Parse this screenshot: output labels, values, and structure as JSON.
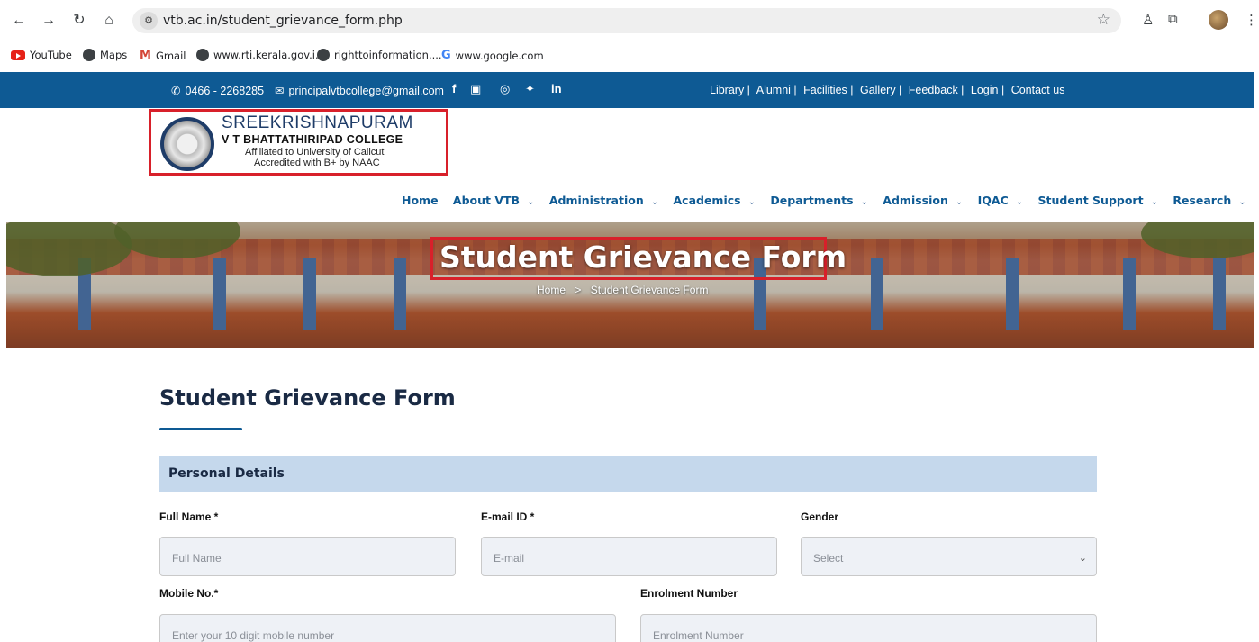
{
  "browser": {
    "url": "vtb.ac.in/student_grievance_form.php",
    "bookmarks": [
      "YouTube",
      "Maps",
      "Gmail",
      "www.rti.kerala.gov.i...",
      "righttoinformation....",
      "www.google.com"
    ]
  },
  "topbar": {
    "phone": "0466 - 2268285",
    "email": "principalvtbcollege@gmail.com",
    "social": [
      "f",
      "You",
      "ig",
      "tw",
      "in"
    ],
    "links": [
      "Library |",
      "Alumni |",
      "Facilities |",
      "Gallery |",
      "Feedback |",
      "Login |",
      "Contact us"
    ]
  },
  "logo": {
    "line1": "SREEKRISHNAPURAM",
    "line2": "V T BHATTATHIRIPAD COLLEGE",
    "line3": "Affiliated to University of Calicut",
    "line4": "Accredited with B+ by NAAC"
  },
  "nav": [
    {
      "label": "Home",
      "dropdown": false
    },
    {
      "label": "About VTB",
      "dropdown": true
    },
    {
      "label": "Administration",
      "dropdown": true
    },
    {
      "label": "Academics",
      "dropdown": true
    },
    {
      "label": "Departments",
      "dropdown": true
    },
    {
      "label": "Admission",
      "dropdown": true
    },
    {
      "label": "IQAC",
      "dropdown": true
    },
    {
      "label": "Student Support",
      "dropdown": true
    },
    {
      "label": "Research",
      "dropdown": true
    }
  ],
  "banner": {
    "title": "Student Grievance Form",
    "crumb_home": "Home",
    "crumb_sep": ">",
    "crumb_current": "Student Grievance Form"
  },
  "content": {
    "heading": "Student Grievance Form",
    "section": "Personal Details",
    "fields": {
      "full_name_label": "Full Name *",
      "full_name_placeholder": "Full Name",
      "email_label": "E-mail ID *",
      "email_placeholder": "E-mail",
      "gender_label": "Gender",
      "gender_value": "Select",
      "mobile_label": "Mobile No.*",
      "mobile_placeholder": "Enter your 10 digit mobile number",
      "enrolment_label": "Enrolment Number",
      "enrolment_placeholder": "Enrolment Number"
    }
  },
  "colors": {
    "primary": "#0e5a94",
    "highlight": "#d8202a",
    "section_bg": "#c5d8ec"
  }
}
